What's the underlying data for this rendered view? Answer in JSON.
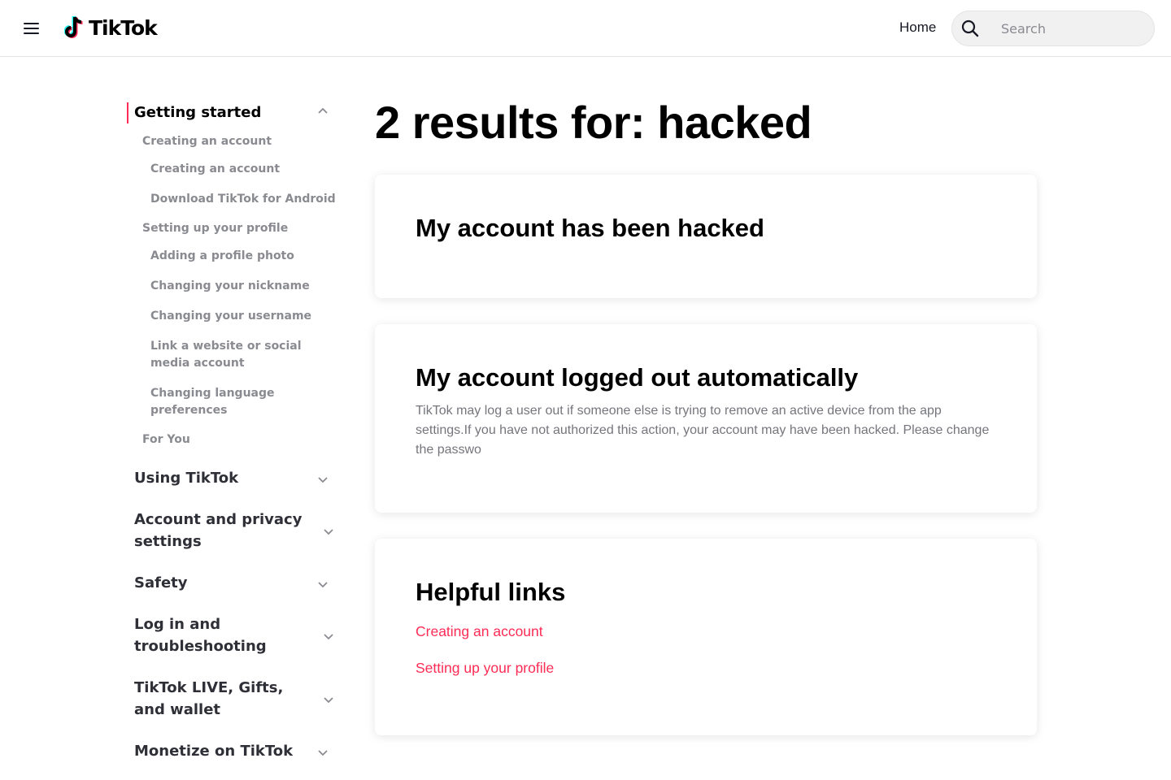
{
  "header": {
    "logo_text": "TikTok",
    "home_label": "Home",
    "search_placeholder": "Search",
    "search_value": ""
  },
  "sidebar": {
    "getting_started": {
      "label": "Getting started",
      "groups": [
        {
          "label": "Creating an account",
          "items": [
            "Creating an account",
            "Download TikTok for Android"
          ]
        },
        {
          "label": "Setting up your profile",
          "items": [
            "Adding a profile photo",
            "Changing your nickname",
            "Changing your username",
            "Link a website or social media account",
            "Changing language preferences"
          ]
        },
        {
          "label": "For You",
          "items": []
        }
      ]
    },
    "categories": [
      "Using TikTok",
      "Account and privacy settings",
      "Safety",
      "Log in and troubleshooting",
      "TikTok LIVE, Gifts, and wallet",
      "Monetize on TikTok"
    ]
  },
  "main": {
    "results_title": "2 results for: hacked",
    "results": [
      {
        "title": "My account has been hacked",
        "snippet": ""
      },
      {
        "title": "My account logged out automatically",
        "snippet": "TikTok may log a user out if someone else is trying to remove an active device from the app settings.If you have not authorized this action, your account may have been hacked. Please change the passwo"
      }
    ],
    "helpful_links": {
      "title": "Helpful links",
      "links": [
        "Creating an account",
        "Setting up your profile"
      ]
    }
  },
  "colors": {
    "accent": "#fe2c55",
    "text": "#161823",
    "muted": "#8a8b91"
  }
}
